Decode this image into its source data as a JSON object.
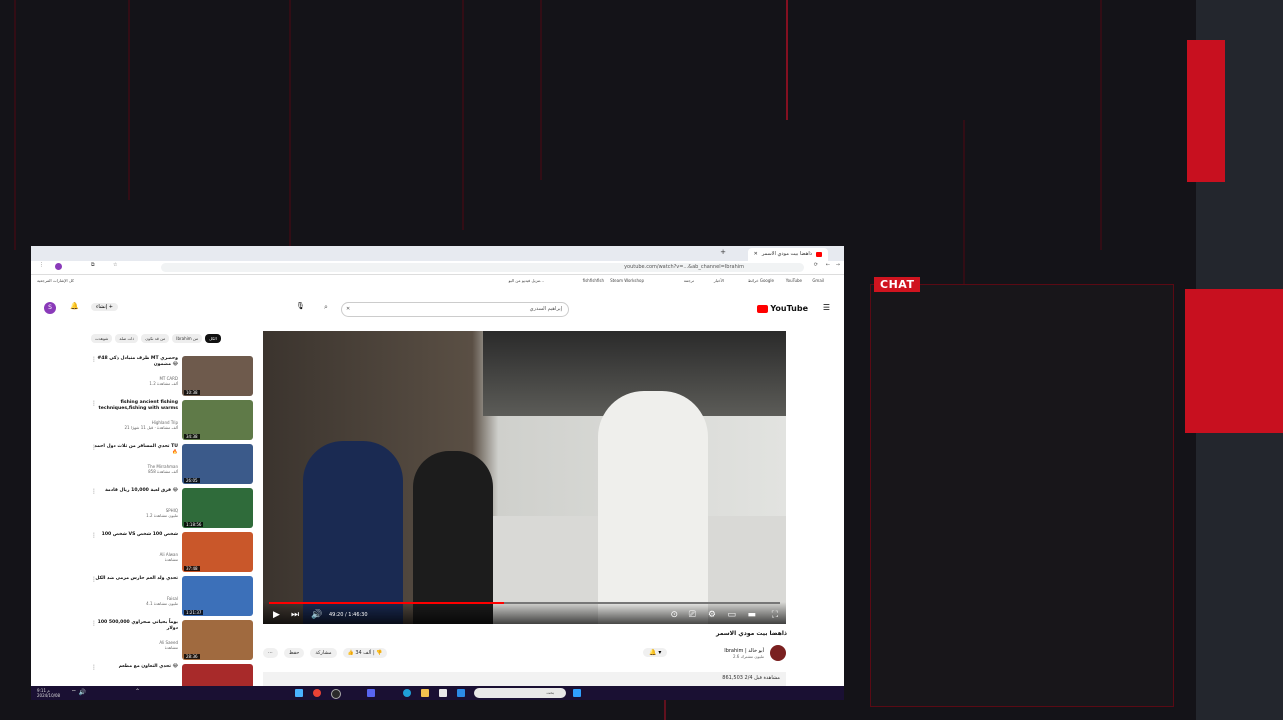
{
  "overlay": {
    "chat_label": "CHAT",
    "accent": "#d0141f"
  },
  "browser": {
    "tab_title": "ذاهضا بيت مودي الاسمر",
    "url": "youtube.com/watch?v=...&ab_channel=Ibrahim",
    "bookmarks": [
      "Gmail",
      "YouTube",
      "خرائط Google",
      "الأخبار",
      "ترجمة",
      "Steam Workshop",
      "fishfishfish",
      "تنزيل فيديو من اليو..."
    ],
    "bookmarks_right": "كل الإشارات المرجعية"
  },
  "youtube": {
    "logo": "YouTube",
    "search_value": "إبراهيم السدري",
    "create_label": "إنشاء",
    "avatar_letter": "S",
    "chips": [
      "الكل",
      "من Ibrahim",
      "من قد نكون",
      "ذات صلة",
      "شوهدت"
    ],
    "video": {
      "time": "49:20 / 1:46:30",
      "progress": 0.46,
      "title": "ذاهضا بيت مودي الاسمر",
      "channel": "Ibrahim | أبو خالد",
      "subscribers": "2.6 مليون مشترك",
      "likes": "34 ألف",
      "share": "مشاركة",
      "save": "حفظ",
      "views": "861,503 مشاهدة  قبل 2/4"
    },
    "recommendations": [
      {
        "title": "#48 ظرف متبادل ذكي MT وحصري مضمون 😂",
        "channel": "MT CARD",
        "meta": "1.2 ألف مشاهدة",
        "duration": "10:38",
        "color": "#6e5a4c"
      },
      {
        "title": "fishing ancient fishing techniques,fishing with warms",
        "channel": "Highland Trip",
        "meta": "21 ألف مشاهدة · قبل 11 شهرًا",
        "duration": "34:38",
        "color": "#5f7a48"
      },
      {
        "title": "تحدي المسافر من ثلاث دول احمد TU 🔥",
        "channel": "The Mirrahman",
        "meta": "858 ألف مشاهدة",
        "duration": "26:05",
        "color": "#3b5a8a"
      },
      {
        "title": "فرق لعبة 10,000 ريال قادمة 😂",
        "channel": "SPHIQ",
        "meta": "1.2 مليون مشاهدة",
        "duration": "1:18:56",
        "color": "#2f6b3a"
      },
      {
        "title": "100 شخص VS شخص 100 شخص",
        "channel": "Ali Alwan",
        "meta": "مشاهدة",
        "duration": "37:48",
        "color": "#c9572a"
      },
      {
        "title": "تحدي ولد العم حارس مرمى ضد الكل",
        "channel": "Faisal",
        "meta": "4.1 مليون مشاهدة",
        "duration": "1:21:37",
        "color": "#3c70b9"
      },
      {
        "title": "100 يوماً بحياتي صحراوي 500,000 دولار",
        "channel": "Ali Saeed",
        "meta": "مشاهدة",
        "duration": "28:36",
        "color": "#a06a3f"
      },
      {
        "title": "تحدي التعاون مع مطعم 😂",
        "channel": "",
        "meta": "",
        "duration": "",
        "color": "#a82a2a"
      }
    ]
  },
  "taskbar": {
    "search": "بحث",
    "time": "9:11 م",
    "date": "2024/10/08"
  }
}
